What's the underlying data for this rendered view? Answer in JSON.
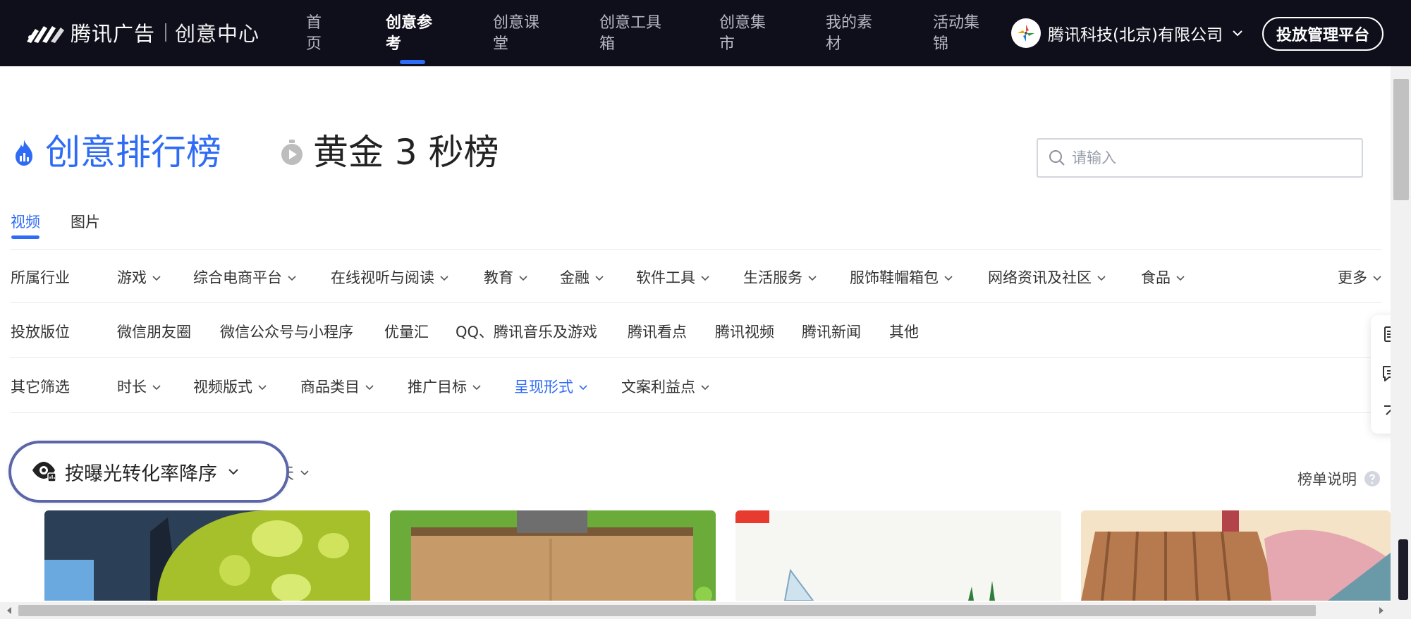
{
  "header": {
    "brand": "腾讯广告",
    "sub_brand": "创意中心",
    "nav": [
      {
        "label": "首页"
      },
      {
        "label": "创意参考"
      },
      {
        "label": "创意课堂"
      },
      {
        "label": "创意工具箱"
      },
      {
        "label": "创意集市"
      },
      {
        "label": "我的素材"
      },
      {
        "label": "活动集锦"
      }
    ],
    "active_nav": "创意参考",
    "account_name": "腾讯科技(北京)有限公司",
    "manage_button": "投放管理平台"
  },
  "page": {
    "rank_title": "创意排行榜",
    "gold_title": "黄金 3 秒榜",
    "search_placeholder": "请输入"
  },
  "tabs": [
    {
      "label": "视频"
    },
    {
      "label": "图片"
    }
  ],
  "active_tab": "视频",
  "filters": {
    "industry": {
      "label": "所属行业",
      "options": [
        "游戏",
        "综合电商平台",
        "在线视听与阅读",
        "教育",
        "金融",
        "软件工具",
        "生活服务",
        "服饰鞋帽箱包",
        "网络资讯及社区",
        "食品"
      ],
      "more": "更多"
    },
    "placement": {
      "label": "投放版位",
      "options": [
        "微信朋友圈",
        "微信公众号与小程序",
        "优量汇",
        "QQ、腾讯音乐及游戏",
        "腾讯看点",
        "腾讯视频",
        "腾讯新闻",
        "其他"
      ]
    },
    "other": {
      "label": "其它筛选",
      "options": [
        "时长",
        "视频版式",
        "商品类目",
        "推广目标",
        "呈现形式",
        "文案利益点"
      ],
      "active": "呈现形式"
    }
  },
  "sort": {
    "label": "按曝光转化率降序",
    "hidden_suffix": "天"
  },
  "explain_label": "榜单说明",
  "colors": {
    "accent": "#2f6cf6",
    "topbar_bg": "#0f0f1c",
    "sort_border": "#5b66a8"
  },
  "icons": {
    "rank": "fire-icon",
    "gold": "stopwatch-icon",
    "search": "search-icon",
    "side_tools": [
      "document-icon",
      "message-icon",
      "back-to-top-icon"
    ],
    "help": "question-icon"
  }
}
